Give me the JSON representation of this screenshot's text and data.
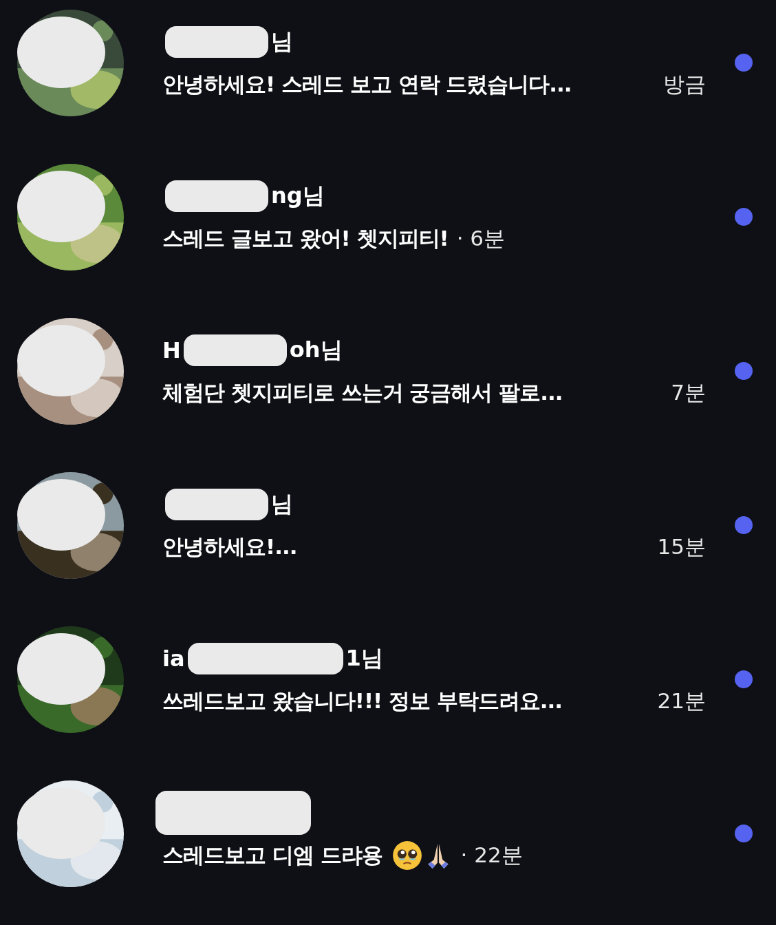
{
  "conversations": [
    {
      "name_end": "님",
      "message": "안녕하세요! 스레드 보고 연락 드렸습니다...",
      "time": "방금",
      "kind": "aligned",
      "unread": true
    },
    {
      "name_end": "ng님",
      "message": "스레드 글보고 왔어! 쳇지피티!",
      "time": "· 6분",
      "kind": "inline",
      "unread": true
    },
    {
      "name_start": "H",
      "name_end": "oh님",
      "message": "체험단 쳇지피티로 쓰는거 궁금해서 팔로...",
      "time": "7분",
      "kind": "aligned",
      "unread": true
    },
    {
      "name_end": "님",
      "message": "안녕하세요!...",
      "time": "15분",
      "kind": "aligned",
      "unread": true
    },
    {
      "name_start": "ia",
      "name_end": "1님",
      "message": "쓰레드보고 왔습니다!!! 정보 부탁드려요...",
      "time": "21분",
      "kind": "aligned",
      "unread": true
    },
    {
      "message": "스레드보고 디엠 드랴용",
      "time": "· 22분",
      "kind": "emoji",
      "unread": true
    }
  ]
}
